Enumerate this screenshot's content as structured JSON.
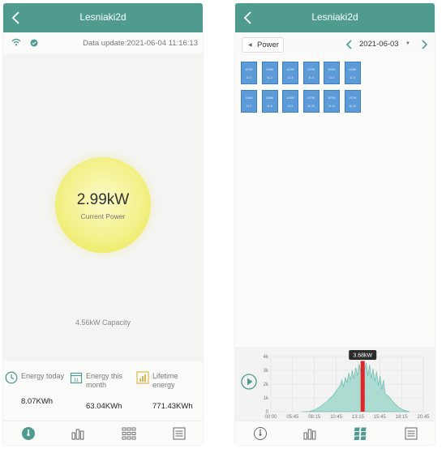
{
  "left_screen": {
    "title": "Lesniaki2d",
    "data_update": "Data update:2021-06-04 11:16:13",
    "current_power_value": "2.99kW",
    "current_power_label": "Current Power",
    "capacity": "4.56kW Capacity",
    "stats": [
      {
        "label_line1": "Energy today",
        "label_line2": "",
        "value": "8.07KWh",
        "icon": "clock-icon"
      },
      {
        "label_line1": "Energy this",
        "label_line2": "month",
        "value": "63.04KWh",
        "icon": "calendar-icon"
      },
      {
        "label_line1": "Lifetime",
        "label_line2": "energy",
        "value": "771.43KWh",
        "icon": "bar-chart-icon"
      }
    ],
    "calendar_day": "31",
    "tabs": [
      "gauge-icon",
      "bar-chart-icon",
      "panels-grid-icon",
      "list-icon"
    ],
    "colors": {
      "appbar": "#4f9c8f",
      "gauge": "#f3f18a"
    }
  },
  "right_screen": {
    "title": "Lesniaki2d",
    "metric_select": "Power",
    "date": "2021-06-03",
    "panels": [
      {
        "power": "107W",
        "id": "11-1"
      },
      {
        "power": "102W",
        "id": "11-2"
      },
      {
        "power": "102W",
        "id": "11-3"
      },
      {
        "power": "107W",
        "id": "11-4"
      },
      {
        "power": "102W",
        "id": "11-5"
      },
      {
        "power": "102W",
        "id": "11-6"
      },
      {
        "power": "104W",
        "id": "11-7"
      },
      {
        "power": "106W",
        "id": "11-8"
      },
      {
        "power": "106W",
        "id": "11-9"
      },
      {
        "power": "107W",
        "id": "11-10"
      },
      {
        "power": "107W",
        "id": "11-11"
      },
      {
        "power": "107W",
        "id": "11-12"
      }
    ],
    "tooltip": "3.68kW",
    "tabs": [
      "gauge-icon",
      "bar-chart-icon",
      "panels-grid-icon",
      "list-icon"
    ],
    "active_tab": "panels-grid-icon",
    "colors": {
      "appbar": "#4f9c8f",
      "panel": "#5c9bd8",
      "area": "#8fcfc4",
      "marker": "#e0262b"
    },
    "chart_data": {
      "type": "area",
      "x_ticks": [
        "00:00",
        "05:45",
        "08:15",
        "10:45",
        "13:15",
        "15:45",
        "18:15",
        "20:45"
      ],
      "y_ticks": [
        "0",
        "1k",
        "2k",
        "3k",
        "4k"
      ],
      "ylim": [
        0,
        4000
      ],
      "xlim_hours": [
        0,
        22
      ],
      "grid": true,
      "points": [
        [
          4.5,
          0
        ],
        [
          5.5,
          20
        ],
        [
          6.0,
          80
        ],
        [
          6.5,
          180
        ],
        [
          7.0,
          320
        ],
        [
          7.5,
          500
        ],
        [
          8.0,
          700
        ],
        [
          8.5,
          950
        ],
        [
          9.0,
          1200
        ],
        [
          9.5,
          1550
        ],
        [
          10.0,
          1900
        ],
        [
          10.25,
          2300
        ],
        [
          10.5,
          1800
        ],
        [
          10.75,
          2500
        ],
        [
          11.0,
          2100
        ],
        [
          11.25,
          2800
        ],
        [
          11.5,
          2300
        ],
        [
          11.75,
          3000
        ],
        [
          12.0,
          2400
        ],
        [
          12.25,
          3200
        ],
        [
          12.5,
          2600
        ],
        [
          12.75,
          3450
        ],
        [
          13.0,
          2800
        ],
        [
          13.25,
          3680
        ],
        [
          13.5,
          3000
        ],
        [
          13.75,
          3550
        ],
        [
          14.0,
          2600
        ],
        [
          14.25,
          3400
        ],
        [
          14.5,
          2400
        ],
        [
          14.75,
          3100
        ],
        [
          15.0,
          2200
        ],
        [
          15.25,
          2900
        ],
        [
          15.5,
          1900
        ],
        [
          15.75,
          2600
        ],
        [
          16.0,
          1600
        ],
        [
          16.25,
          2300
        ],
        [
          16.5,
          1300
        ],
        [
          17.0,
          1100
        ],
        [
          17.5,
          800
        ],
        [
          18.0,
          520
        ],
        [
          18.5,
          300
        ],
        [
          19.0,
          150
        ],
        [
          19.5,
          60
        ],
        [
          20.0,
          0
        ]
      ],
      "marker_x_hours": 13.25,
      "marker_value_kw": 3.68
    }
  }
}
